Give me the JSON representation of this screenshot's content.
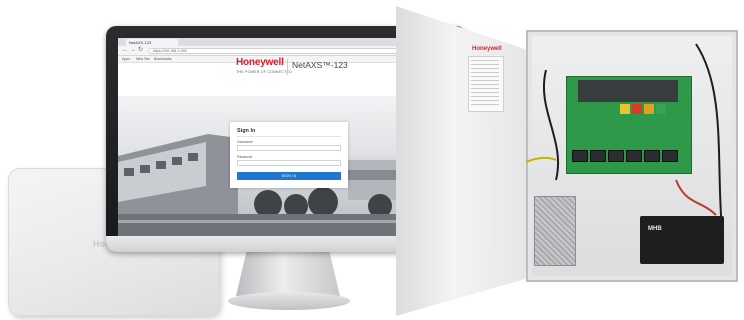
{
  "browser": {
    "tab_title": "NetAXS-123",
    "address": "https://192.168.1.150/",
    "bookmarks": [
      "Apps",
      "New Tab",
      "Bookmarks"
    ]
  },
  "page": {
    "brand": "Honeywell",
    "tagline": "THE POWER OF CONNECTED",
    "product": "NetAXS™-123",
    "signin": {
      "title": "Sign In",
      "username_label": "Username",
      "password_label": "Password",
      "button_label": "SIGN IN"
    }
  },
  "hardware": {
    "enclosure_label": "Honeywell",
    "door_brand": "Honeywell",
    "battery_label": "MHB"
  },
  "colors": {
    "brand_red": "#d6202b",
    "signin_blue": "#1f77d0",
    "board_green": "#2e9a49"
  }
}
